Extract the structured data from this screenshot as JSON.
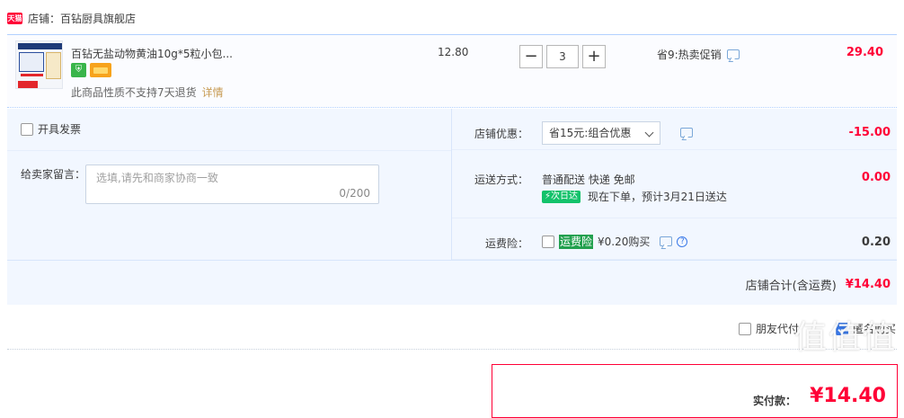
{
  "shop": {
    "logo_text": "天猫",
    "label": "店铺：百钻厨具旗舰店"
  },
  "item": {
    "title": "百钻无盐动物黄油10g*5粒小包...",
    "tags": [
      "green-shield-icon",
      "orange-card-icon"
    ],
    "return_note": "此商品性质不支持7天退货",
    "detail_link": "详情",
    "unit_price": "12.80",
    "quantity": "3",
    "minus": "−",
    "plus": "+",
    "promo": "省9:热卖促销",
    "total": "29.40"
  },
  "options": {
    "invoice_label": "开具发票",
    "memo_label": "给卖家留言：",
    "memo_placeholder": "选填,请先和商家协商一致",
    "memo_count": "0/200",
    "discount_label": "店铺优惠：",
    "discount_value": "省15元:组合优惠",
    "discount_amount": "-15.00",
    "shipping_label": "运送方式：",
    "shipping_method": "普通配送 快递 免邮",
    "shipping_badge": "次日达",
    "shipping_eta": "现在下单，预计3月21日送达",
    "shipping_amount": "0.00",
    "insurance_label": "运费险：",
    "insurance_tag": "运费险",
    "insurance_price": "¥0.20购买",
    "insurance_amount": "0.20",
    "qmark": "?",
    "subtotal_label": "店铺合计(含运费)",
    "subtotal_value": "¥14.40"
  },
  "footer": {
    "friend_pay": "朋友代付",
    "anonymous": "匿名购买",
    "anonymous_checked": true,
    "final_label": "实付款：",
    "final_value": "¥14.40",
    "watermark": "值值值"
  },
  "colors": {
    "accent_red": "#ff0036",
    "accent_blue": "#3a79e8",
    "row_bg": "#f2f7ff"
  }
}
